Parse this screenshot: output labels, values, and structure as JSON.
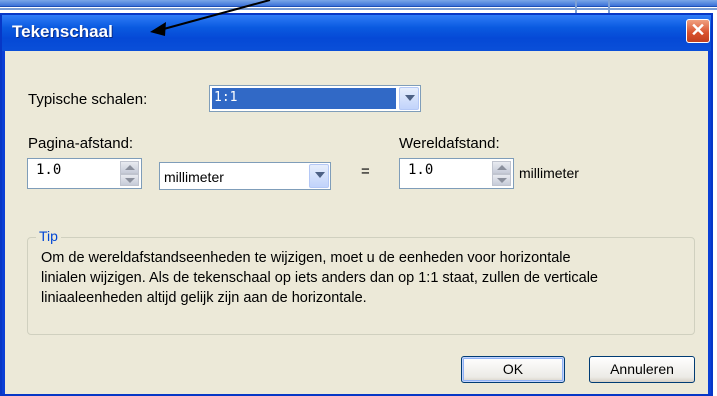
{
  "dialog": {
    "title": "Tekenschaal",
    "close_label": "✕"
  },
  "scale": {
    "label": "Typische schalen:",
    "value": "1:1"
  },
  "page_distance": {
    "label": "Pagina-afstand:",
    "value": "1.0",
    "unit": "millimeter"
  },
  "equals": "=",
  "world_distance": {
    "label": "Wereldafstand:",
    "value": "1.0",
    "unit": "millimeter"
  },
  "tip": {
    "legend": "Tip",
    "line1": "Om de wereldafstandseenheden te wijzigen, moet u de eenheden voor horizontale",
    "line2": "linialen wijzigen. Als de tekenschaal op iets anders dan op 1:1 staat, zullen de verticale",
    "line3": "liniaaleenheden altijd gelijk zijn aan de horizontale."
  },
  "buttons": {
    "ok": "OK",
    "cancel": "Annuleren"
  },
  "colors": {
    "titlebar": "#0a5ae0",
    "dialog_bg": "#ece9d8",
    "tip_legend": "#0046d5",
    "selection": "#3169c6"
  }
}
